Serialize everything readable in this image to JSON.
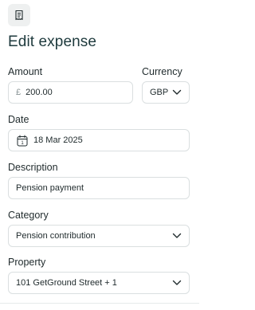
{
  "header": {
    "icon": "receipt-icon",
    "title": "Edit expense"
  },
  "form": {
    "amount": {
      "label": "Amount",
      "currency_symbol": "£",
      "value": "200.00"
    },
    "currency": {
      "label": "Currency",
      "value": "GBP"
    },
    "date": {
      "label": "Date",
      "value": "18 Mar 2025",
      "calendar_day": "1"
    },
    "description": {
      "label": "Description",
      "value": "Pension payment"
    },
    "category": {
      "label": "Category",
      "value": "Pension contribution"
    },
    "property": {
      "label": "Property",
      "value": "101 GetGround Street + 1"
    }
  },
  "colors": {
    "title": "#1e3a3d",
    "border": "#dadfe0",
    "icon_tile_bg": "#eef0f0"
  }
}
